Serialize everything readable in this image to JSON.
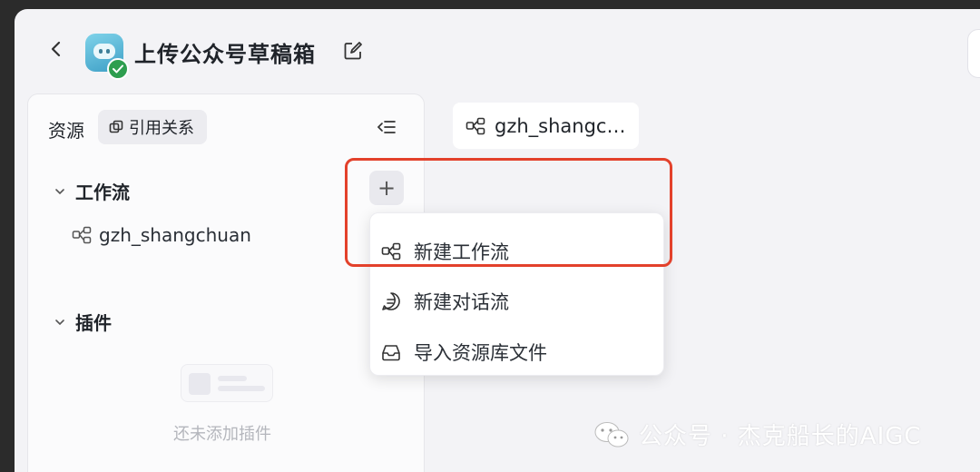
{
  "header": {
    "app_title": "上传公众号草稿箱"
  },
  "sidebar": {
    "resources_label": "资源",
    "references_button": "引用关系",
    "workflow_section": "工作流",
    "workflow_items": [
      "gzh_shangchuan"
    ],
    "plugin_section": "插件",
    "plugin_empty_text": "还未添加插件"
  },
  "editor": {
    "open_tab": "gzh_shangchuan"
  },
  "add_menu": {
    "items": [
      "新建工作流",
      "新建对话流",
      "导入资源库文件"
    ]
  },
  "watermark": {
    "text": "公众号 · 杰克船长的AIGC"
  },
  "colors": {
    "highlight": "#e3412b",
    "status_green": "#2e9e4f"
  }
}
